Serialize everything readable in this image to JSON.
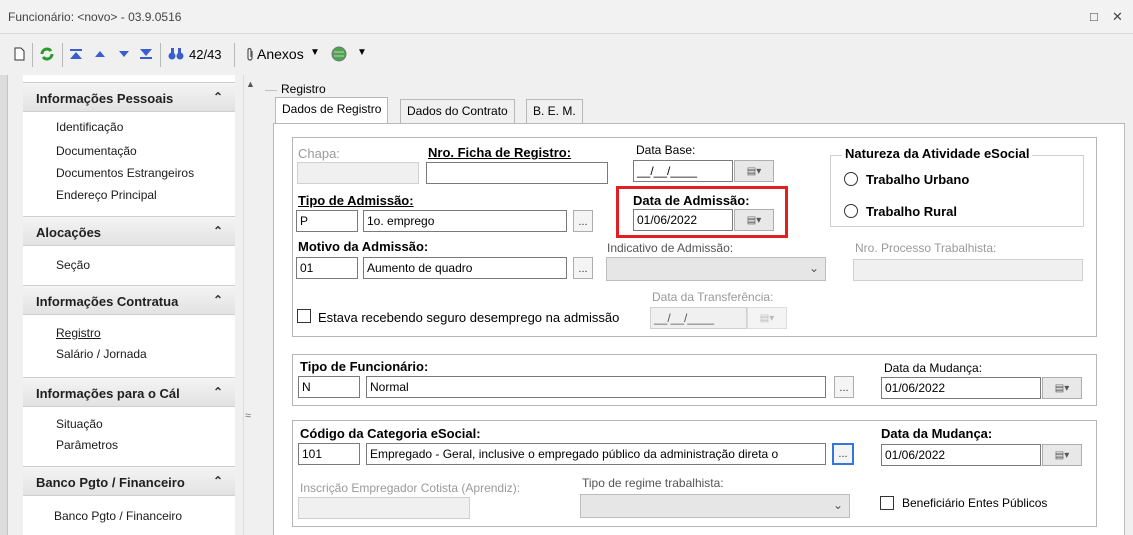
{
  "window": {
    "title": "Funcionário: <novo> - 03.9.0516",
    "restore": "□",
    "close": "✕"
  },
  "toolbar": {
    "new_icon": "document-icon",
    "refresh_icon": "refresh-icon",
    "first_icon": "first-icon",
    "prev_icon": "previous-icon",
    "next_icon": "next-icon",
    "last_icon": "last-icon",
    "search_icon": "binoculars-icon",
    "record_count": "42/43",
    "attachments_label": "Anexos",
    "globe_icon": "globe-icon"
  },
  "nav": {
    "sections": [
      {
        "label": "Informações Pessoais",
        "items": [
          "Identificação",
          "Documentação",
          "Documentos Estrangeiros",
          "Endereço Principal"
        ]
      },
      {
        "label": "Alocações",
        "items": [
          "Seção"
        ]
      },
      {
        "label": "Informações Contratua",
        "items": [
          "Registro",
          "Salário / Jornada"
        ]
      },
      {
        "label": "Informações para o Cál",
        "items": [
          "Situação",
          "Parâmetros"
        ]
      },
      {
        "label": "Banco Pgto / Financeiro",
        "items": [
          "Banco Pgto / Financeiro"
        ]
      }
    ],
    "collapse_glyph": "≈"
  },
  "main": {
    "group_title": "Registro",
    "tabs": [
      "Dados de Registro",
      "Dados do Contrato",
      "B. E. M."
    ],
    "form": {
      "chapa_label": "Chapa:",
      "ficha_label": "Nro. Ficha de Registro:",
      "data_base_label": "Data Base:",
      "data_base_value": "__/__/____",
      "natureza_title": "Natureza da Atividade eSocial",
      "natureza_options": [
        "Trabalho Urbano",
        "Trabalho Rural"
      ],
      "tipo_admissao_label": "Tipo de Admissão:",
      "tipo_admissao_code": "P",
      "tipo_admissao_desc": "1o. emprego",
      "data_admissao_label": "Data de Admissão:",
      "data_admissao_value": "01/06/2022",
      "motivo_label": "Motivo da Admissão:",
      "motivo_code": "01",
      "motivo_desc": "Aumento de quadro",
      "indicativo_label": "Indicativo de Admissão:",
      "processo_label": "Nro. Processo Trabalhista:",
      "data_transf_label": "Data da Transferência:",
      "data_transf_value": "__/__/____",
      "seguro_label": "Estava recebendo seguro desemprego na admissão",
      "tipo_func_label": "Tipo de Funcionário:",
      "tipo_func_code": "N",
      "tipo_func_desc": "Normal",
      "data_mudanca_label": "Data da Mudança:",
      "data_mudanca_value": "01/06/2022",
      "categoria_label": "Código da Categoria eSocial:",
      "categoria_code": "101",
      "categoria_desc": "Empregado - Geral, inclusive o empregado público da administração direta o",
      "data_mudanca2_label": "Data da Mudança:",
      "data_mudanca2_value": "01/06/2022",
      "inscricao_label": "Inscrição Empregador Cotista (Aprendiz):",
      "regime_label": "Tipo de regime trabalhista:",
      "beneficiario_label": "Beneficiário Entes Públicos",
      "ellipsis": "...",
      "highlight_color": "#e02020"
    }
  }
}
